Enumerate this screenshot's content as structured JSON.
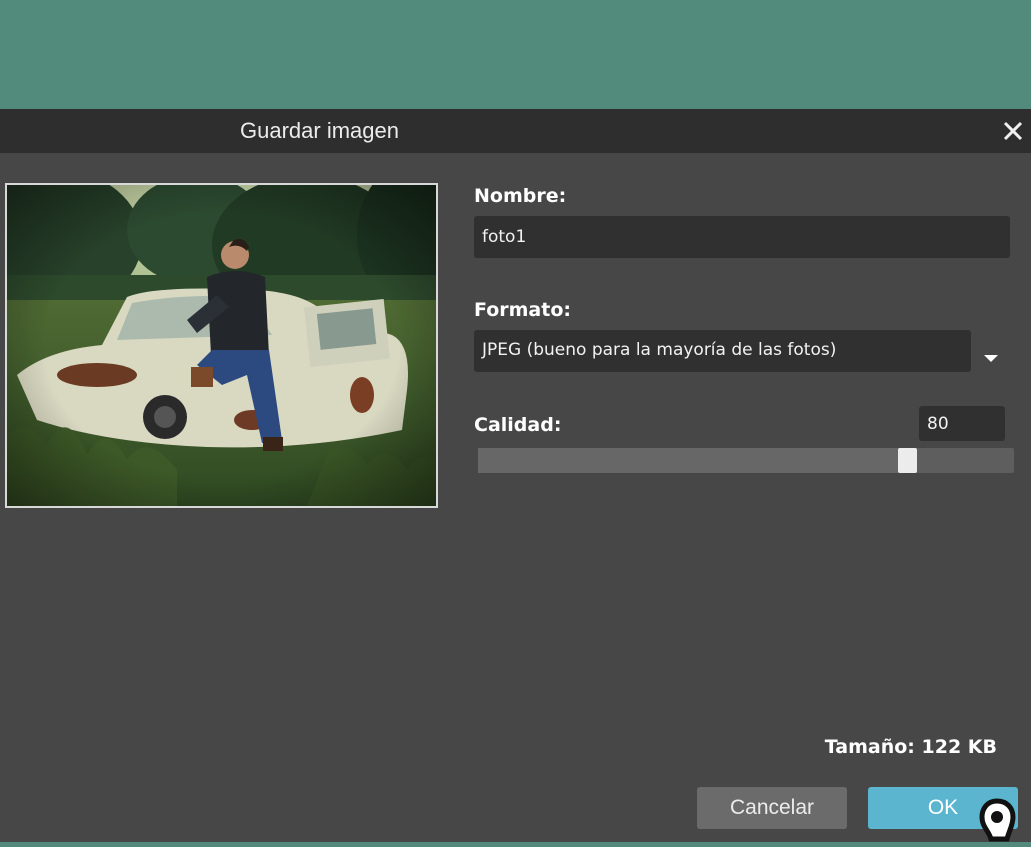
{
  "dialog": {
    "title": "Guardar imagen",
    "close_icon": "close-icon"
  },
  "preview": {
    "description_icon": "image-preview"
  },
  "name": {
    "label": "Nombre:",
    "value": "foto1"
  },
  "format": {
    "label": "Formato:",
    "selected": "JPEG (bueno para la mayoría de las fotos)",
    "arrow_icon": "chevron-down-icon"
  },
  "quality": {
    "label": "Calidad:",
    "value": "80",
    "slider_fraction": 0.8
  },
  "size": {
    "text": "Tamaño: 122 KB"
  },
  "buttons": {
    "cancel": "Cancelar",
    "ok": "OK"
  },
  "colors": {
    "background": "#528a7b",
    "dialog": "#474747",
    "titlebar": "#2e2e2e",
    "ok_button": "#5bb5cf"
  }
}
